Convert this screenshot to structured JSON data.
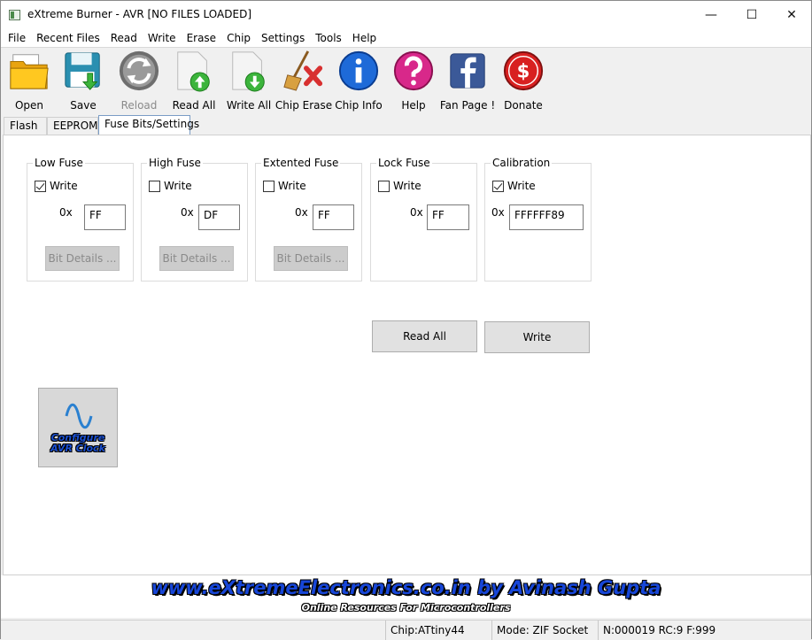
{
  "window": {
    "title": "eXtreme Burner - AVR [NO FILES LOADED]",
    "controls": {
      "minimize": "—",
      "maximize": "☐",
      "close": "✕"
    }
  },
  "menu": [
    "File",
    "Recent Files",
    "Read",
    "Write",
    "Erase",
    "Chip",
    "Settings",
    "Tools",
    "Help"
  ],
  "toolbar": {
    "open": "Open",
    "save": "Save",
    "reload": "Reload",
    "read_all": "Read All",
    "write_all": "Write All",
    "chip_erase": "Chip Erase",
    "chip_info": "Chip Info",
    "help": "Help",
    "fan_page": "Fan Page !",
    "donate": "Donate",
    "icons": {
      "open": "folder-open-icon",
      "save": "floppy-save-icon",
      "reload": "reload-icon",
      "read_all": "chip-read-icon",
      "write_all": "chip-write-icon",
      "chip_erase": "broom-erase-icon",
      "chip_info": "info-icon",
      "help": "question-icon",
      "fan_page": "facebook-icon",
      "donate": "dollar-icon"
    },
    "reload_enabled": false
  },
  "tabs": [
    {
      "label": "Flash",
      "active": false
    },
    {
      "label": "EEPROM",
      "active": false
    },
    {
      "label": "Fuse Bits/Settings",
      "active": true
    }
  ],
  "fuses": [
    {
      "title": "Low Fuse",
      "write_label": "Write",
      "checked": true,
      "prefix": "0x",
      "value": "FF",
      "bit_details": "Bit Details ..."
    },
    {
      "title": "High Fuse",
      "write_label": "Write",
      "checked": false,
      "prefix": "0x",
      "value": "DF",
      "bit_details": "Bit Details ..."
    },
    {
      "title": "Extented Fuse",
      "write_label": "Write",
      "checked": false,
      "prefix": "0x",
      "value": "FF",
      "bit_details": "Bit Details ..."
    },
    {
      "title": "Lock Fuse",
      "write_label": "Write",
      "checked": false,
      "prefix": "0x",
      "value": "FF"
    },
    {
      "title": "Calibration",
      "write_label": "Write",
      "checked": true,
      "prefix": "0x",
      "value": "FFFFFF89"
    }
  ],
  "actions": {
    "read_all": "Read All",
    "write": "Write"
  },
  "clock": {
    "line1": "Configure",
    "line2": "AVR Clock",
    "icon": "sine-wave-icon"
  },
  "banner": {
    "title": "www.eXtremeElectronics.co.in by Avinash Gupta",
    "subtitle": "Online Resources For Microcontrollers"
  },
  "status": {
    "chip": "Chip:ATtiny44",
    "mode": "Mode: ZIF Socket",
    "counter": "N:000019 RC:9 F:999"
  },
  "colors": {
    "accent": "#1746d8",
    "disabled_text": "#8a8a8a",
    "tab_border": "#7a9cc6"
  }
}
